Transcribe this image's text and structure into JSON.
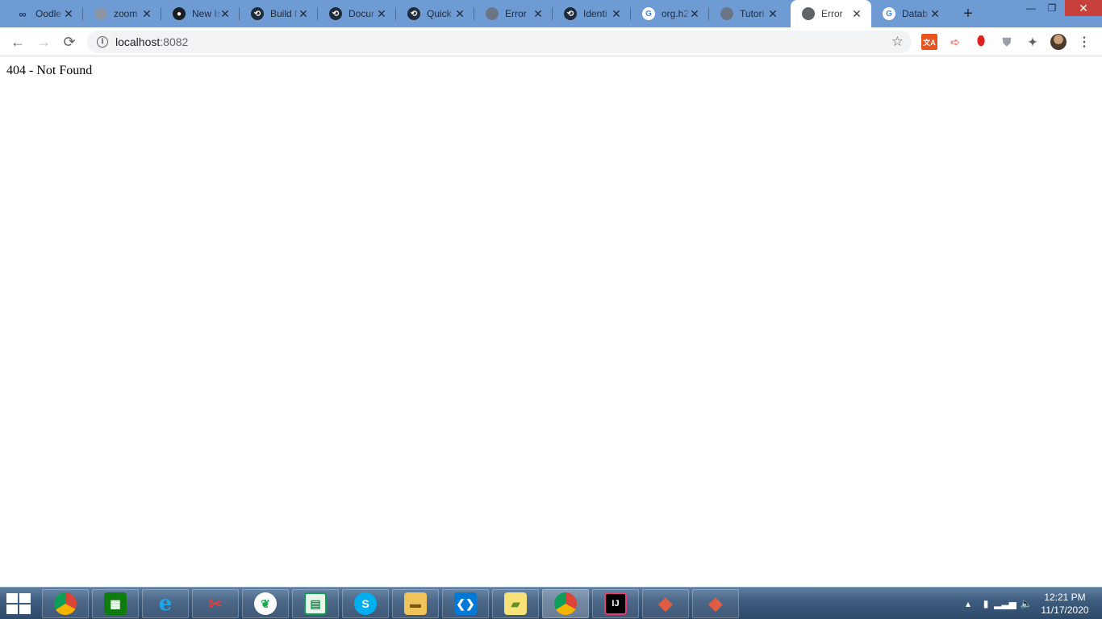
{
  "browser": {
    "tabs": [
      {
        "title": "Oodle",
        "favicon": "link-icon",
        "color": "#1a3a6e"
      },
      {
        "title": "zoom",
        "favicon": "globe-icon",
        "color": "#8a96a6"
      },
      {
        "title": "New Is",
        "favicon": "github-icon",
        "color": "#1b1f23"
      },
      {
        "title": "Build f",
        "favicon": "gatsby-icon",
        "color": "#1f2a3a"
      },
      {
        "title": "Docur",
        "favicon": "gatsby-icon",
        "color": "#1f2a3a"
      },
      {
        "title": "Quick",
        "favicon": "gatsby-icon",
        "color": "#1f2a3a"
      },
      {
        "title": "Error",
        "favicon": "globe-icon",
        "color": "#6a7686"
      },
      {
        "title": "Identi",
        "favicon": "gatsby-icon",
        "color": "#1f2a3a"
      },
      {
        "title": "org.h2",
        "favicon": "google-icon",
        "color": "#4285f4"
      },
      {
        "title": "Tutori",
        "favicon": "globe-icon",
        "color": "#6a7686"
      },
      {
        "title": "Error",
        "favicon": "globe-icon",
        "color": "#5f6368",
        "active": true
      },
      {
        "title": "Datab",
        "favicon": "google-icon",
        "color": "#4285f4"
      }
    ],
    "url_host": "localhost",
    "url_port": ":8082",
    "extensions": [
      "translate-icon",
      "pointer-icon",
      "opera-icon",
      "shield-icon",
      "puzzle-icon",
      "profile-avatar"
    ]
  },
  "page": {
    "message": "404 - Not Found"
  },
  "taskbar": {
    "apps": [
      "chrome",
      "store",
      "internet-explorer",
      "snipping-tool",
      "mongodb-compass",
      "spreadsheet",
      "skype",
      "file-explorer",
      "vscode",
      "sticky-notes",
      "chrome-active",
      "intellij",
      "git-gui",
      "git-gui"
    ],
    "time": "12:21 PM",
    "date": "11/17/2020"
  }
}
